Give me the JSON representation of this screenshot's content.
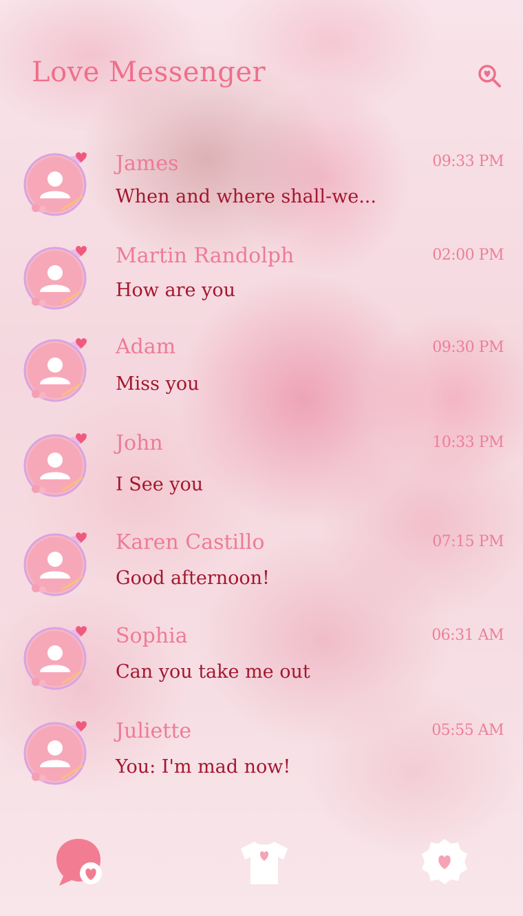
{
  "app": {
    "title": "Love Messenger"
  },
  "header": {
    "search_icon": "search-heart-icon"
  },
  "conversations": [
    {
      "name": "James",
      "message": "When and where shall-we...",
      "time": "09:33 PM"
    },
    {
      "name": "Martin Randolph",
      "message": "How are you",
      "time": "02:00 PM"
    },
    {
      "name": "Adam",
      "message": "Miss you",
      "time": "09:30 PM"
    },
    {
      "name": "John",
      "message": "I See you",
      "time": "10:33 PM"
    },
    {
      "name": "Karen Castillo",
      "message": "Good afternoon!",
      "time": "07:15 PM"
    },
    {
      "name": "Sophia",
      "message": "Can you take me out",
      "time": "06:31 AM"
    },
    {
      "name": "Juliette",
      "message": "You: I'm mad now!",
      "time": "05:55 AM"
    }
  ],
  "bottom_nav": {
    "items": [
      {
        "icon": "chat-heart-icon",
        "active": true
      },
      {
        "icon": "theme-shirt-icon",
        "active": false
      },
      {
        "icon": "settings-gear-heart-icon",
        "active": false
      }
    ]
  },
  "colors": {
    "accent": "#ef6f8a",
    "name": "#ee7b96",
    "message": "#a3172f",
    "time": "#ec7f98"
  }
}
